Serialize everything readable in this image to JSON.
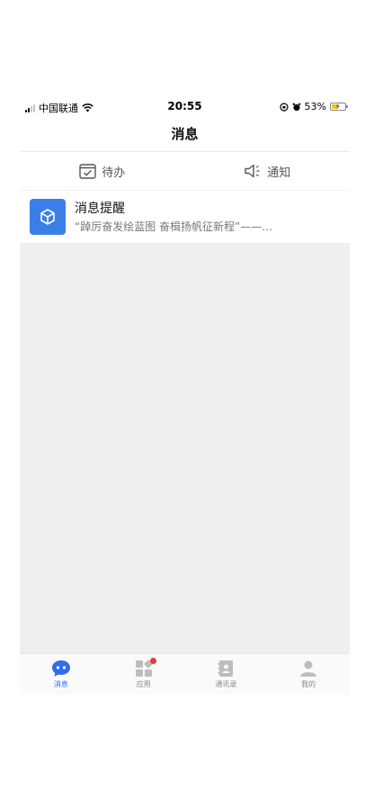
{
  "status_bar": {
    "carrier": "中国联通",
    "time": "20:55",
    "battery": "53%",
    "battery_level": 0.53
  },
  "nav": {
    "title": "消息"
  },
  "segments": [
    {
      "label": "待办",
      "icon": "calendar-check-icon",
      "badge": false
    },
    {
      "label": "通知",
      "icon": "speaker-icon",
      "badge": true
    }
  ],
  "messages": [
    {
      "title": "消息提醒",
      "preview": "“踔厉奋发绘蓝图 奋楫扬帆征新程”——…",
      "icon": "cube-icon"
    }
  ],
  "tab_bar": [
    {
      "label": "消息",
      "icon": "chat-bubble-icon",
      "active": true,
      "badge": false
    },
    {
      "label": "应用",
      "icon": "apps-grid-icon",
      "active": false,
      "badge": true
    },
    {
      "label": "通讯录",
      "icon": "contacts-book-icon",
      "active": false,
      "badge": false
    },
    {
      "label": "我的",
      "icon": "user-icon",
      "active": false,
      "badge": false
    }
  ],
  "colors": {
    "accent": "#2f6ee6",
    "avatar": "#3b7ee8",
    "badge": "#e53935",
    "content_bg": "#efefef"
  }
}
